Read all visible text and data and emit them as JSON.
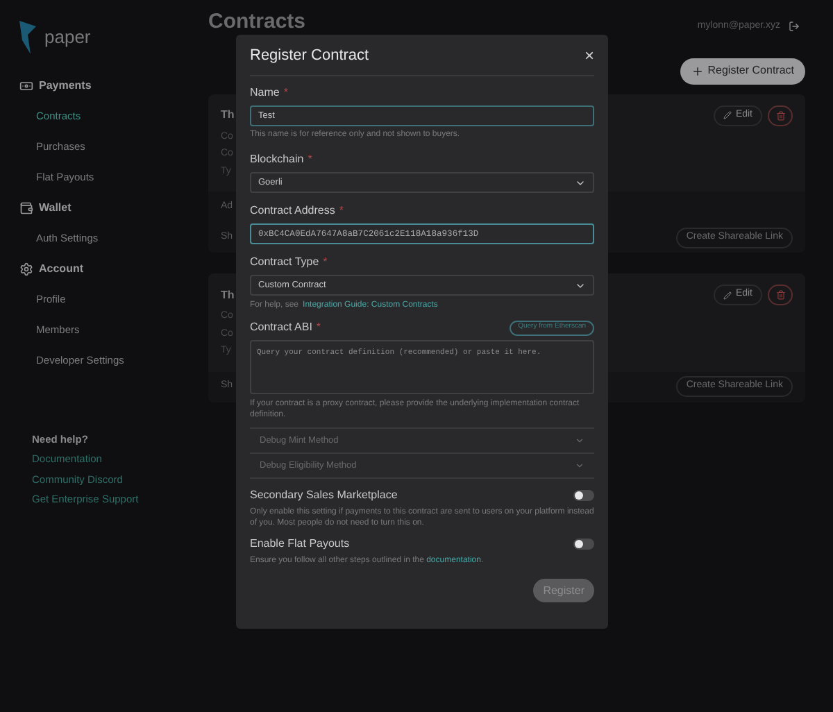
{
  "brand": {
    "name": "paper"
  },
  "sidebar": {
    "sections": [
      {
        "title": "Payments",
        "items": [
          {
            "label": "Contracts",
            "selected": true
          },
          {
            "label": "Purchases",
            "selected": false
          },
          {
            "label": "Flat Payouts",
            "selected": false
          }
        ]
      },
      {
        "title": "Wallet",
        "items": [
          {
            "label": "Auth Settings",
            "selected": false
          }
        ]
      },
      {
        "title": "Account",
        "items": [
          {
            "label": "Profile",
            "selected": false
          },
          {
            "label": "Members",
            "selected": false
          },
          {
            "label": "Developer Settings",
            "selected": false
          }
        ]
      }
    ],
    "help": {
      "title": "Need help?",
      "links": [
        "Documentation",
        "Community Discord",
        "Get Enterprise Support"
      ]
    }
  },
  "header": {
    "title": "Contracts",
    "user": "mylonn@paper.xyz"
  },
  "register_button": "Register Contract",
  "cards": [
    {
      "title": "Th",
      "rows": [
        "Co",
        "Co",
        "Ty"
      ],
      "footer": [
        "Ad",
        "Sh"
      ],
      "edit": "Edit",
      "share": "Create Shareable Link"
    },
    {
      "title": "Th",
      "rows": [
        "Co",
        "Co",
        "Ty"
      ],
      "footer": [
        "Sh"
      ],
      "edit": "Edit",
      "share": "Create Shareable Link"
    }
  ],
  "modal": {
    "title": "Register Contract",
    "close": "×",
    "name": {
      "label": "Name",
      "required": "*",
      "value": "Test",
      "help": "This name is for reference only and not shown to buyers."
    },
    "blockchain": {
      "label": "Blockchain",
      "required": "*",
      "value": "Goerli"
    },
    "address": {
      "label": "Contract Address",
      "required": "*",
      "value": "0xBC4CA0EdA7647A8aB7C2061c2E118A18a936f13D"
    },
    "type": {
      "label": "Contract Type",
      "required": "*",
      "value": "Custom Contract",
      "help": "For help, see",
      "link": "Integration Guide: Custom Contracts"
    },
    "abi": {
      "label": "Contract ABI",
      "required": "*",
      "query": "Query from Etherscan",
      "placeholder": "Query your contract definition (recommended) or paste it here.",
      "help": "If your contract is a proxy contract, please provide the underlying implementation contract definition."
    },
    "debug": [
      {
        "label": "Debug Mint Method",
        "expanded": false
      },
      {
        "label": "Debug Eligibility Method",
        "expanded": false
      }
    ],
    "toggles": [
      {
        "label": "Secondary Sales Marketplace",
        "on": false,
        "help": "Only enable this setting if payments to this contract are sent to users on your platform instead of you. Most people do not need to turn this on."
      },
      {
        "label": "Enable Flat Payouts",
        "on": false,
        "help": "Ensure you follow all other steps outlined in the",
        "link": "documentation",
        "after": "."
      }
    ],
    "submit": "Register"
  }
}
